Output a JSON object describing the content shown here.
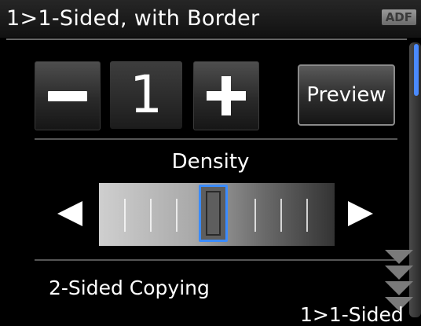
{
  "header": {
    "title": "1>1-Sided, with Border",
    "badge": "ADF"
  },
  "copies": {
    "minus_icon": "minus-icon",
    "count": "1",
    "plus_icon": "plus-icon"
  },
  "preview": {
    "label": "Preview"
  },
  "density": {
    "label": "Density",
    "level": 4,
    "levels": 9
  },
  "settings": [
    {
      "label": "2-Sided Copying",
      "value": "1>1-Sided"
    }
  ],
  "colors": {
    "accent": "#3a8bff",
    "background": "#000000",
    "text": "#ffffff"
  }
}
